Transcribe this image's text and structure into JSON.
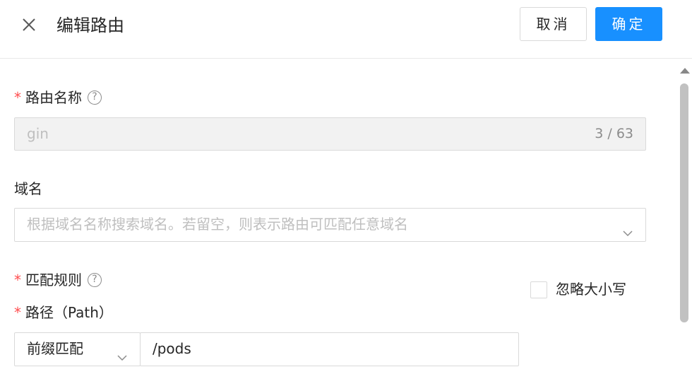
{
  "header": {
    "title": "编辑路由",
    "cancel_label": "取消",
    "ok_label": "确定"
  },
  "route_name": {
    "label": "路由名称",
    "value": "gin",
    "count": "3 / 63"
  },
  "domain": {
    "label": "域名",
    "placeholder": "根据域名名称搜索域名。若留空，则表示路由可匹配任意域名"
  },
  "match_rules": {
    "label": "匹配规则"
  },
  "path": {
    "label": "路径（Path）",
    "match_type": "前缀匹配",
    "value": "/pods",
    "ignore_case_label": "忽略大小写"
  },
  "icons": {
    "close": "close-icon",
    "help": "question-circle-icon",
    "chevron": "chevron-down-icon"
  },
  "colors": {
    "primary": "#1890ff",
    "required": "#ff4d4f"
  }
}
